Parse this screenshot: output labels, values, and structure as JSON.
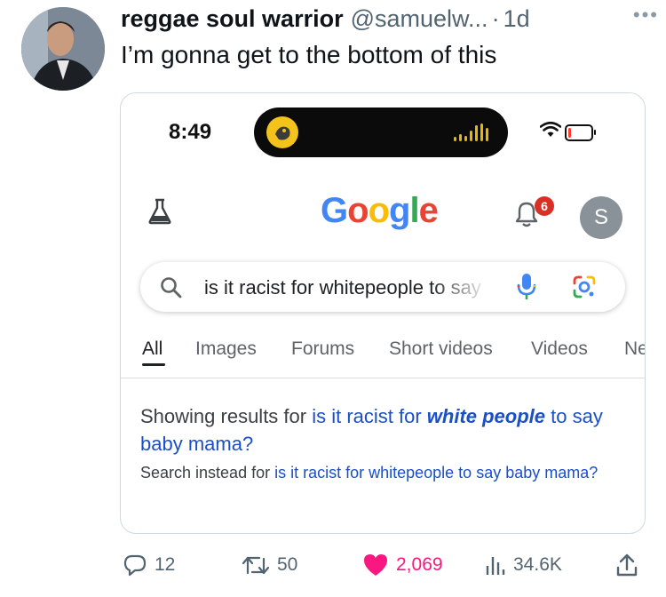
{
  "tweet": {
    "display_name": "reggae soul warrior",
    "handle": "@samuelw...",
    "separator": "·",
    "time": "1d",
    "text": "I’m gonna get to the bottom of this",
    "more_icon": "more-icon"
  },
  "phone": {
    "status_time": "8:49",
    "google_logo": [
      "G",
      "o",
      "o",
      "g",
      "l",
      "e"
    ],
    "notification_count": "6",
    "account_initial": "S",
    "search_query": "is it racist for whitepeople to say baby mama?",
    "tabs": [
      "All",
      "Images",
      "Forums",
      "Short videos",
      "Videos",
      "News"
    ],
    "showing_prefix": "Showing results for ",
    "showing_link_1": "is it racist for ",
    "showing_link_bold": "white people",
    "showing_link_2": " to say baby mama?",
    "instead_prefix": "Search instead for ",
    "instead_link": "is it racist for whitepeople to say baby mama?"
  },
  "actions": {
    "replies": "12",
    "retweets": "50",
    "likes": "2,069",
    "views": "34.6K"
  },
  "colors": {
    "like": "#f91880",
    "link": "#1a0dab",
    "muted": "#536471"
  }
}
